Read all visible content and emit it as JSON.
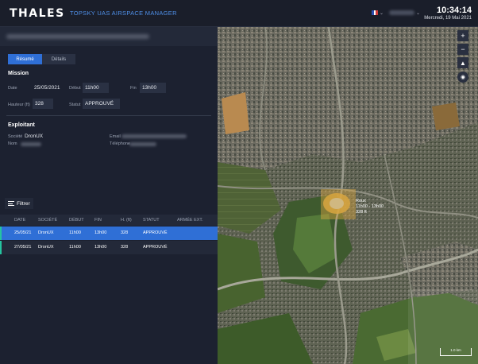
{
  "header": {
    "logo": "THALES",
    "product": "TOPSKY UAS AIRSPACE MANAGER",
    "time": "10:34:14",
    "date": "Mercredi, 19 Mai 2021"
  },
  "tabs": {
    "resume": "Résumé",
    "details": "Détails"
  },
  "mission": {
    "title": "Mission",
    "date_label": "Date",
    "date_value": "25/05/2021",
    "debut_label": "Début",
    "debut_value": "11h00",
    "fin_label": "Fin",
    "fin_value": "13h00",
    "hauteur_label": "Hauteur (ft)",
    "hauteur_value": "328",
    "statut_label": "Statut",
    "statut_value": "APPROUVÉ"
  },
  "exploitant": {
    "title": "Exploitant",
    "societe_label": "Société",
    "societe_value": "DronUX",
    "nom_label": "Nom",
    "email_label": "Email",
    "telephone_label": "Téléphone"
  },
  "filter": {
    "label": "Filtrer"
  },
  "table": {
    "headers": [
      "DATE",
      "SOCIÉTÉ",
      "DÉBUT",
      "FIN",
      "H. (ft)",
      "STATUT",
      "ARMÉE EXT."
    ],
    "rows": [
      [
        "25/05/21",
        "DronUX",
        "11h00",
        "13h00",
        "328",
        "APPROUVÉ",
        ""
      ],
      [
        "27/05/21",
        "DronUX",
        "11h00",
        "13h00",
        "328",
        "APPROUVÉ",
        ""
      ]
    ]
  },
  "map": {
    "zone_name": "Roux",
    "zone_time": "11h00 - 13h00",
    "zone_height": "328 ft",
    "zoom_in": "+",
    "zoom_out": "−",
    "scale": "1.0 km"
  },
  "colors": {
    "accent_blue": "#2f6fd6",
    "row_accent": "#25c4a0",
    "zone_fill": "#d9a640"
  },
  "icons": [
    "filter-icon",
    "compass-icon",
    "layers-icon",
    "chevron-down-icon",
    "flag-fr-icon"
  ]
}
